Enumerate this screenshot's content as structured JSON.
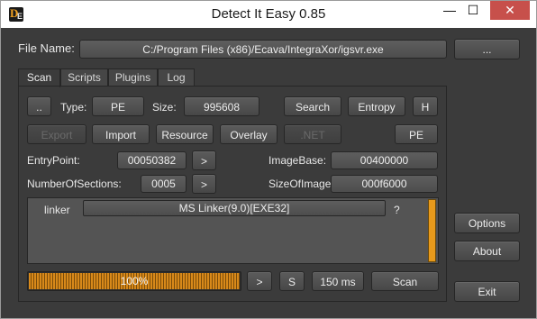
{
  "window": {
    "title": "Detect It Easy 0.85"
  },
  "titlebar": {
    "minimize_glyph": "—",
    "maximize_glyph": "☐",
    "close_glyph": "✕"
  },
  "app_icon": {
    "letter": "D",
    "sub": "E"
  },
  "file": {
    "label": "File Name:",
    "path": "C:/Program Files (x86)/Ecava/IntegraXor/igsvr.exe",
    "browse_label": "..."
  },
  "tabs": [
    {
      "label": "Scan",
      "active": true
    },
    {
      "label": "Scripts",
      "active": false
    },
    {
      "label": "Plugins",
      "active": false
    },
    {
      "label": "Log",
      "active": false
    }
  ],
  "scan": {
    "up_label": "..",
    "type_label": "Type:",
    "type_value": "PE",
    "size_label": "Size:",
    "size_value": "995608",
    "search_label": "Search",
    "entropy_label": "Entropy",
    "hex_label": "H",
    "export_label": "Export",
    "import_label": "Import",
    "resource_label": "Resource",
    "overlay_label": "Overlay",
    "net_label": ".NET",
    "pe_label": "PE",
    "entrypoint_label": "EntryPoint:",
    "entrypoint_value": "00050382",
    "entrypoint_go": ">",
    "imagebase_label": "ImageBase:",
    "imagebase_value": "00400000",
    "sections_label": "NumberOfSections:",
    "sections_value": "0005",
    "sections_go": ">",
    "sizeofimage_label": "SizeOfImage:",
    "sizeofimage_value": "000f6000",
    "result": {
      "type": "linker",
      "name": "MS Linker(9.0)[EXE32]",
      "info": "?"
    },
    "progress": {
      "percent": 100,
      "text": "100%"
    },
    "next_label": ">",
    "s_label": "S",
    "time_label": "150 ms",
    "scan_label": "Scan"
  },
  "side": {
    "options_label": "Options",
    "about_label": "About",
    "exit_label": "Exit"
  },
  "colors": {
    "accent": "#e79a1c",
    "background": "#3b3b3b",
    "close": "#c7504b"
  }
}
